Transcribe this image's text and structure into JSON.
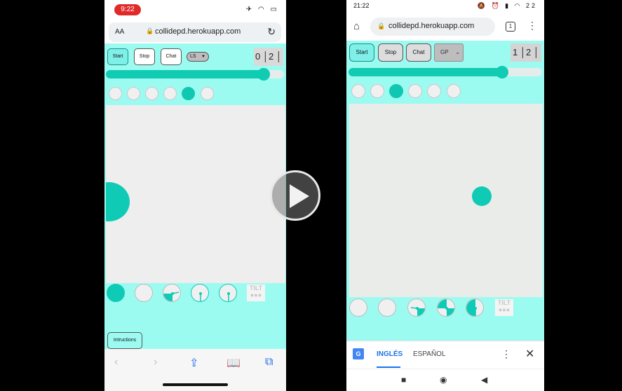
{
  "left_phone": {
    "status_time": "9:22",
    "status_icons": "✈ ◠ ▭",
    "text_size_control": "AA",
    "url": "collidepd.herokuapp.com",
    "app": {
      "start_label": "Start",
      "stop_label": "Stop",
      "chat_label": "Chat",
      "mode_select_value": "LS",
      "score": "0 │2 │",
      "slider_value_fraction": 0.9,
      "dots_selected_index": 4,
      "instructions_label": "Intructions",
      "tilt_label": "TILT"
    }
  },
  "right_phone": {
    "status_time": "21:22",
    "status_icons": "🔕 ⏰ ▮ ◠ 22",
    "url": "collidepd.herokuapp.com",
    "tab_count": "1",
    "app": {
      "start_label": "Start",
      "stop_label": "Stop",
      "chat_label": "Chat",
      "mode_select_value": "GP",
      "score": "1 │2 │",
      "slider_value_fraction": 0.8,
      "dots_selected_index": 2,
      "tilt_label": "TILT"
    },
    "translate_bar": {
      "tab_english": "INGLÉS",
      "tab_spanish": "ESPAÑOL"
    }
  },
  "icons": [
    "play-icon",
    "lock-icon",
    "reload-icon",
    "home-icon",
    "menu-icon",
    "close-icon",
    "back-icon",
    "forward-icon",
    "share-icon",
    "bookmarks-icon",
    "tabs-icon",
    "google-translate-icon"
  ]
}
